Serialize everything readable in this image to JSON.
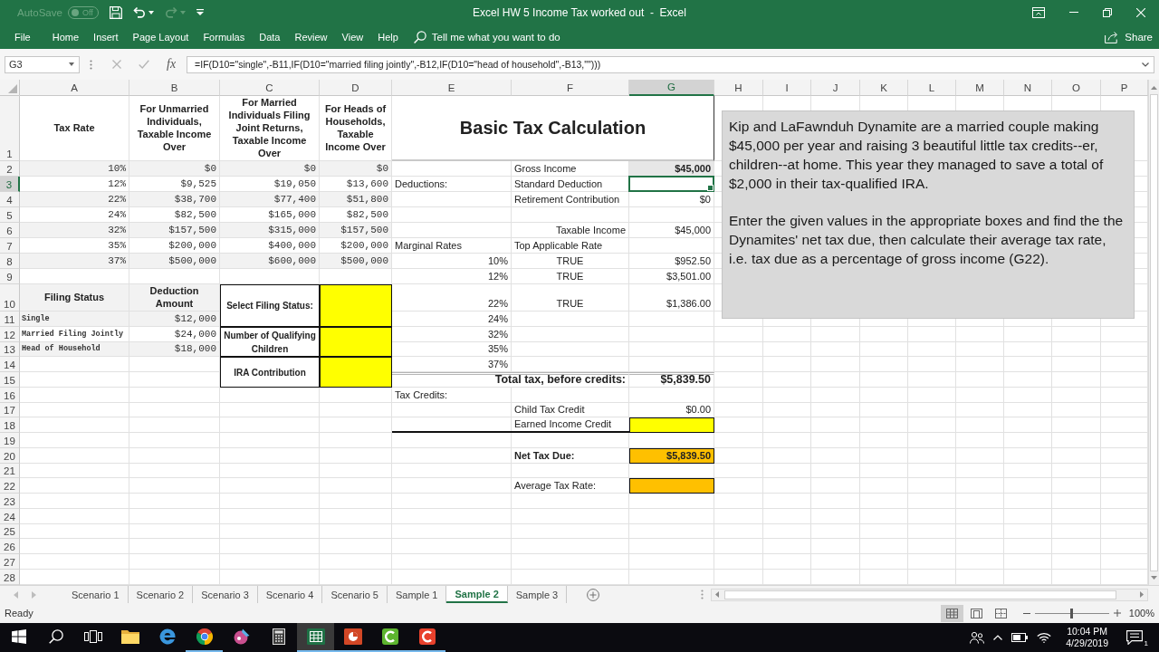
{
  "window": {
    "title": "Excel HW 5 Income Tax worked out  -  Excel",
    "autosave": {
      "label": "AutoSave",
      "state": "Off",
      "on": false
    }
  },
  "quick_access": [
    {
      "kind": "save",
      "disabled": false
    },
    {
      "kind": "undo",
      "disabled": false
    },
    {
      "kind": "redo",
      "disabled": true
    },
    {
      "kind": "customize",
      "disabled": false
    }
  ],
  "ribbon_tabs": [
    {
      "label": "File",
      "selected": false
    },
    {
      "label": "Home",
      "selected": false
    },
    {
      "label": "Insert",
      "selected": false
    },
    {
      "label": "Page Layout",
      "selected": false
    },
    {
      "label": "Formulas",
      "selected": false
    },
    {
      "label": "Data",
      "selected": false
    },
    {
      "label": "Review",
      "selected": false
    },
    {
      "label": "View",
      "selected": false
    },
    {
      "label": "Help",
      "selected": false
    }
  ],
  "tell_me": {
    "placeholder": "Tell me what you want to do"
  },
  "share": {
    "label": "Share"
  },
  "formula_bar": {
    "name_box": "G3",
    "function_label": "fx",
    "formula": "=IF(D10=\"single\",-B11,IF(D10=\"married filing jointly\",-B12,IF(D10=\"head of household\",-B13,\"\")))"
  },
  "sheet": {
    "columns": [
      {
        "label": "A",
        "selected": false
      },
      {
        "label": "B",
        "selected": false
      },
      {
        "label": "C",
        "selected": false
      },
      {
        "label": "D",
        "selected": false
      },
      {
        "label": "E",
        "selected": false
      },
      {
        "label": "F",
        "selected": false
      },
      {
        "label": "G",
        "selected": true
      },
      {
        "label": "H",
        "selected": false
      },
      {
        "label": "I",
        "selected": false
      },
      {
        "label": "J",
        "selected": false
      },
      {
        "label": "K",
        "selected": false
      },
      {
        "label": "L",
        "selected": false
      },
      {
        "label": "M",
        "selected": false
      },
      {
        "label": "N",
        "selected": false
      },
      {
        "label": "O",
        "selected": false
      },
      {
        "label": "P",
        "selected": false
      }
    ],
    "rows": [
      {
        "label": "1",
        "selected": false
      },
      {
        "label": "2",
        "selected": false
      },
      {
        "label": "3",
        "selected": true
      },
      {
        "label": "4",
        "selected": false
      },
      {
        "label": "5",
        "selected": false
      },
      {
        "label": "6",
        "selected": false
      },
      {
        "label": "7",
        "selected": false
      },
      {
        "label": "8",
        "selected": false
      },
      {
        "label": "9",
        "selected": false
      },
      {
        "label": "10",
        "selected": false
      },
      {
        "label": "11",
        "selected": false
      },
      {
        "label": "12",
        "selected": false
      },
      {
        "label": "13",
        "selected": false
      },
      {
        "label": "14",
        "selected": false
      },
      {
        "label": "15",
        "selected": false
      },
      {
        "label": "16",
        "selected": false
      },
      {
        "label": "17",
        "selected": false
      },
      {
        "label": "18",
        "selected": false
      },
      {
        "label": "19",
        "selected": false
      },
      {
        "label": "20",
        "selected": false
      },
      {
        "label": "21",
        "selected": false
      },
      {
        "label": "22",
        "selected": false
      },
      {
        "label": "23",
        "selected": false
      },
      {
        "label": "24",
        "selected": false
      },
      {
        "label": "25",
        "selected": false
      },
      {
        "label": "26",
        "selected": false
      },
      {
        "label": "27",
        "selected": false
      },
      {
        "label": "28",
        "selected": false
      }
    ]
  },
  "tax_table": {
    "columns": [
      "Tax Rate",
      "For Unmarried Individuals, Taxable Income Over",
      "For Married Individuals Filing Joint Returns, Taxable Income Over",
      "For Heads of Households, Taxable Income Over"
    ],
    "rows": [
      [
        "10%",
        "$0",
        "$0",
        "$0"
      ],
      [
        "12%",
        "$9,525",
        "$19,050",
        "$13,600"
      ],
      [
        "22%",
        "$38,700",
        "$77,400",
        "$51,800"
      ],
      [
        "24%",
        "$82,500",
        "$165,000",
        "$82,500"
      ],
      [
        "32%",
        "$157,500",
        "$315,000",
        "$157,500"
      ],
      [
        "35%",
        "$200,000",
        "$400,000",
        "$200,000"
      ],
      [
        "37%",
        "$500,000",
        "$600,000",
        "$500,000"
      ]
    ]
  },
  "filing_status_table": {
    "columns": [
      "Filing Status",
      "Deduction Amount"
    ],
    "rows": [
      [
        "Single",
        "$12,000"
      ],
      [
        "Married Filing Jointly",
        "$24,000"
      ],
      [
        "Head of Household",
        "$18,000"
      ]
    ]
  },
  "inputs": [
    {
      "label": "Select Filing Status:"
    },
    {
      "label": "Number of Qualifying Children"
    },
    {
      "label": "IRA Contribution"
    }
  ],
  "calculation": {
    "title": "Basic Tax Calculation",
    "rows": [
      {
        "kind": "given",
        "label": "Gross Income",
        "value": "$45,000"
      },
      {
        "kind": "item",
        "section": "Deductions:",
        "label": "Standard Deduction"
      },
      {
        "kind": "item",
        "label": "Retirement Contribution",
        "value": "$0"
      },
      {
        "kind": "blank"
      },
      {
        "kind": "subtotal",
        "label": "Taxable Income",
        "value": "$45,000"
      },
      {
        "kind": "item",
        "section": "Marginal Rates",
        "label": "Top Applicable Rate"
      },
      {
        "kind": "bracket",
        "rate": "10%",
        "label": "TRUE",
        "value": "$952.50"
      },
      {
        "kind": "bracket",
        "rate": "12%",
        "label": "TRUE",
        "value": "$3,501.00"
      },
      {
        "kind": "bracket",
        "rate": "22%",
        "label": "TRUE",
        "value": "$1,386.00"
      },
      {
        "kind": "bracket",
        "rate": "24%"
      },
      {
        "kind": "bracket",
        "rate": "32%"
      },
      {
        "kind": "bracket",
        "rate": "35%"
      },
      {
        "kind": "bracket",
        "rate": "37%"
      },
      {
        "kind": "total",
        "label": "Total tax, before credits:",
        "value": "$5,839.50"
      },
      {
        "kind": "item",
        "section": "Tax Credits:"
      },
      {
        "kind": "item",
        "label": "Child Tax Credit",
        "value": "$0.00"
      },
      {
        "kind": "input",
        "label": "Earned Income Credit"
      },
      {
        "kind": "blank"
      },
      {
        "kind": "result",
        "label": "Net Tax Due:",
        "value": "$5,839.50"
      },
      {
        "kind": "blank"
      },
      {
        "kind": "answer",
        "label": "Average Tax Rate:"
      }
    ]
  },
  "note": {
    "paragraphs": [
      "Kip and LaFawnduh Dynamite are a married couple making $45,000 per year and raising 3 beautiful little tax credits--er, children--at home. This year they managed to save a total of $2,000 in their tax-qualified IRA.",
      "Enter the given values in the appropriate boxes and find the the Dynamites' net tax due, then calculate their average tax rate, i.e. tax due as a percentage of gross income (G22)."
    ]
  },
  "sheet_tabs": [
    {
      "label": "Scenario 1",
      "selected": false
    },
    {
      "label": "Scenario 2",
      "selected": false
    },
    {
      "label": "Scenario 3",
      "selected": false
    },
    {
      "label": "Scenario 4",
      "selected": false
    },
    {
      "label": "Scenario 5",
      "selected": false
    },
    {
      "label": "Sample 1",
      "selected": false
    },
    {
      "label": "Sample 2",
      "selected": true
    },
    {
      "label": "Sample 3",
      "selected": false
    }
  ],
  "status_bar": {
    "status": "Ready",
    "views": [
      {
        "kind": "normal",
        "selected": true
      },
      {
        "kind": "page_layout",
        "selected": false
      },
      {
        "kind": "page_break",
        "selected": false
      }
    ],
    "zoom_slider": {
      "level": 0.5
    },
    "zoom": "100%"
  },
  "taskbar": {
    "apps": [
      {
        "kind": "start",
        "running": false,
        "selected": false
      },
      {
        "kind": "search",
        "running": false,
        "selected": false
      },
      {
        "kind": "task_view",
        "running": false,
        "selected": false
      },
      {
        "kind": "folder",
        "running": false,
        "selected": false
      },
      {
        "kind": "browser_e",
        "running": false,
        "selected": false
      },
      {
        "kind": "browser_ball",
        "running": true,
        "selected": false
      },
      {
        "kind": "paint",
        "running": false,
        "selected": false
      },
      {
        "kind": "calculator",
        "running": false,
        "selected": false
      },
      {
        "kind": "spreadsheet",
        "running": true,
        "selected": true
      },
      {
        "kind": "presentation",
        "running": true,
        "selected": false
      },
      {
        "kind": "editor",
        "running": true,
        "selected": false
      },
      {
        "kind": "recorder",
        "running": true,
        "selected": false
      }
    ],
    "time": "10:04 PM",
    "date": "4/29/2019",
    "notifications": "1"
  }
}
